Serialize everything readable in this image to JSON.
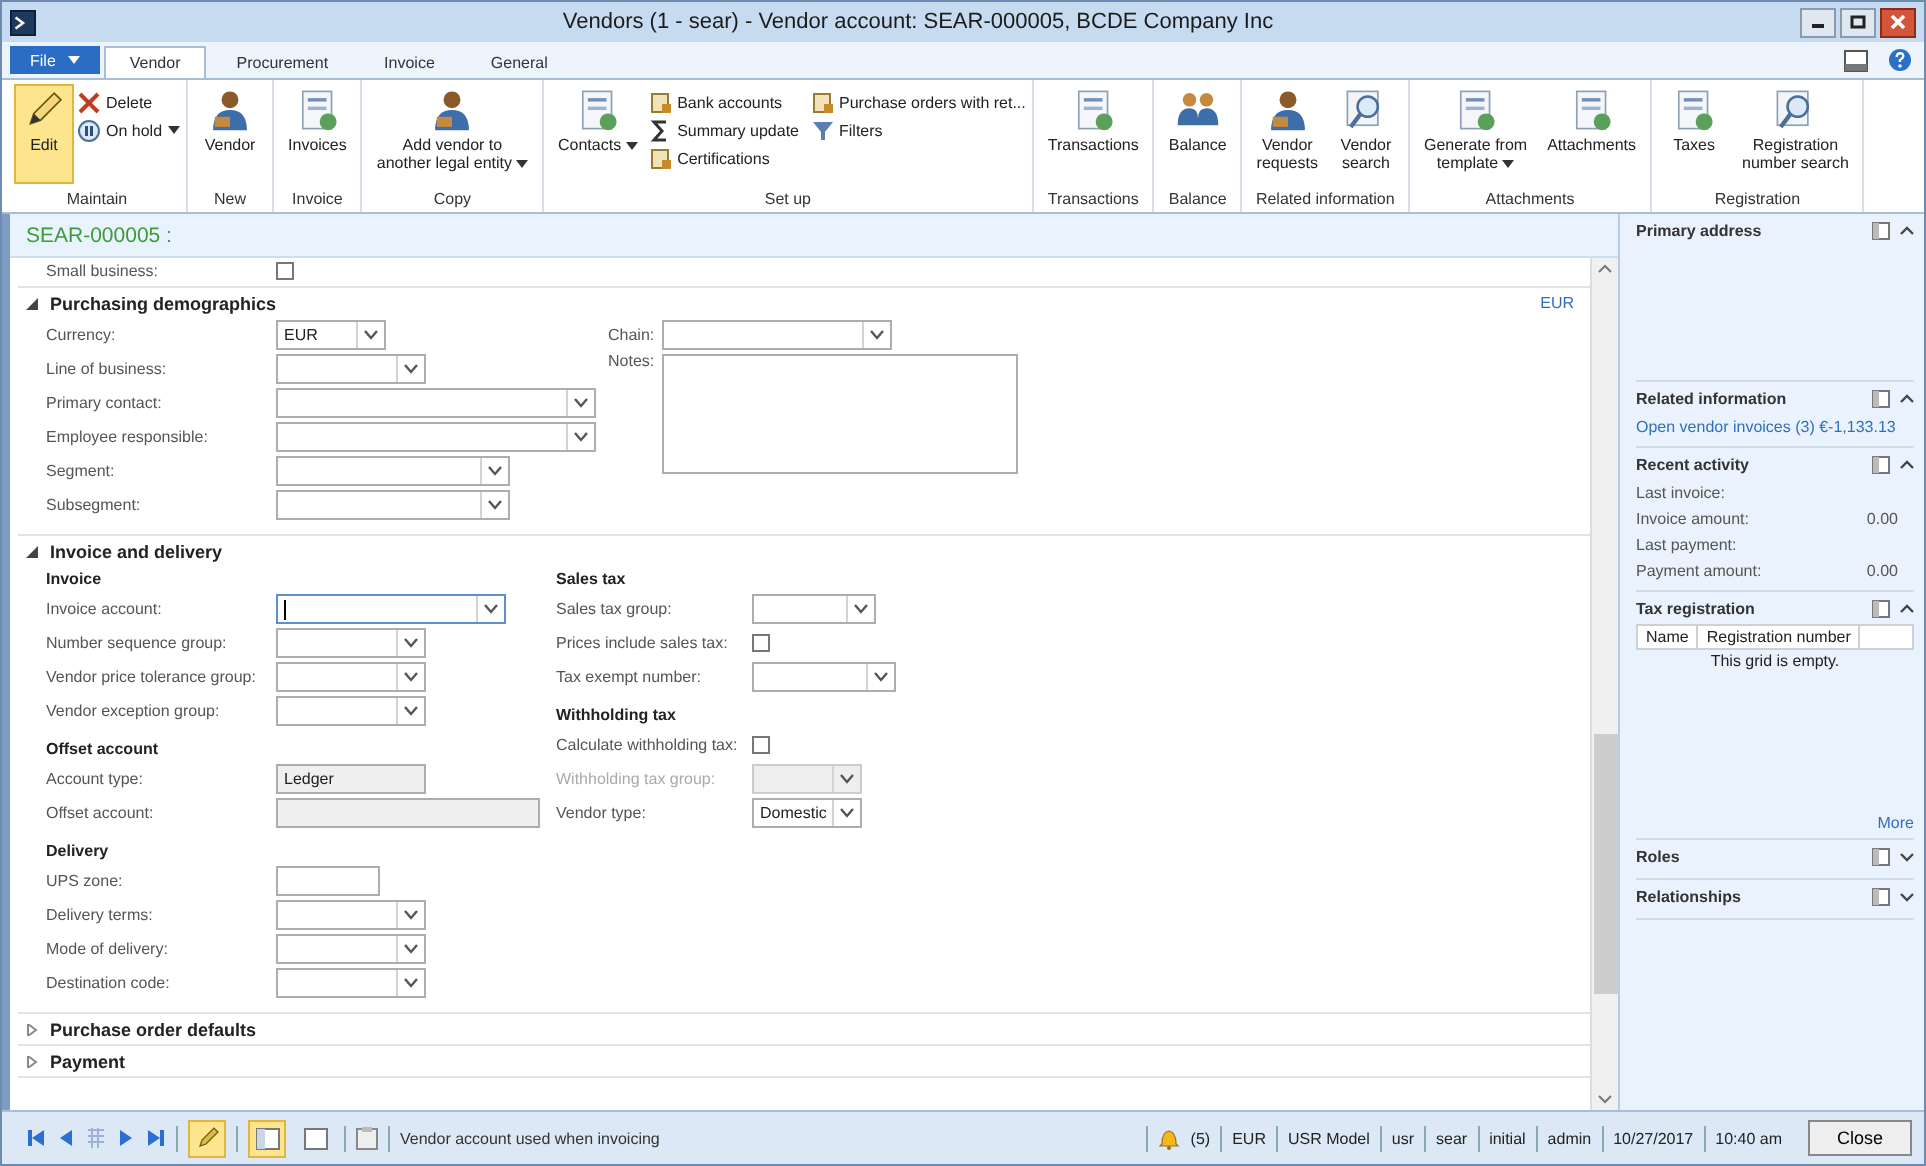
{
  "window": {
    "title": "Vendors (1 - sear) - Vendor account: SEAR-000005, BCDE Company Inc"
  },
  "tabs": [
    {
      "label": "File",
      "kind": "file",
      "selected": false
    },
    {
      "label": "Vendor",
      "kind": "tab",
      "selected": true
    },
    {
      "label": "Procurement",
      "kind": "tab",
      "selected": false
    },
    {
      "label": "Invoice",
      "kind": "tab",
      "selected": false
    },
    {
      "label": "General",
      "kind": "tab",
      "selected": false
    }
  ],
  "ribbon": {
    "groups": [
      {
        "label": "Maintain",
        "buttons": [
          {
            "label": "Edit",
            "kind": "large",
            "on": true
          },
          {
            "label": "Delete",
            "kind": "small",
            "on": false
          },
          {
            "label": "On hold",
            "kind": "small",
            "on": false,
            "dropdown": true
          }
        ]
      },
      {
        "label": "New",
        "buttons": [
          {
            "label": "Vendor",
            "kind": "large",
            "on": false
          }
        ]
      },
      {
        "label": "Invoice",
        "buttons": [
          {
            "label": "Invoices",
            "kind": "large",
            "on": false
          }
        ]
      },
      {
        "label": "Copy",
        "buttons": [
          {
            "label": "Add vendor to\nanother legal entity",
            "kind": "large",
            "on": false,
            "dropdown": true
          }
        ]
      },
      {
        "label": "Set up",
        "buttons": [
          {
            "label": "Contacts",
            "kind": "large",
            "on": false,
            "dropdown": true
          },
          {
            "label": "Bank accounts",
            "kind": "small",
            "on": false
          },
          {
            "label": "Summary update",
            "kind": "small",
            "on": false
          },
          {
            "label": "Certifications",
            "kind": "small",
            "on": false
          },
          {
            "label": "Purchase orders with ret...",
            "kind": "small",
            "on": false
          },
          {
            "label": "Filters",
            "kind": "small",
            "on": false
          }
        ]
      },
      {
        "label": "Transactions",
        "buttons": [
          {
            "label": "Transactions",
            "kind": "large",
            "on": false
          }
        ]
      },
      {
        "label": "Balance",
        "buttons": [
          {
            "label": "Balance",
            "kind": "large",
            "on": false
          }
        ]
      },
      {
        "label": "Related information",
        "buttons": [
          {
            "label": "Vendor\nrequests",
            "kind": "large",
            "on": false
          },
          {
            "label": "Vendor\nsearch",
            "kind": "large",
            "on": false
          }
        ]
      },
      {
        "label": "Attachments",
        "buttons": [
          {
            "label": "Generate from\ntemplate",
            "kind": "large",
            "on": false,
            "dropdown": true
          },
          {
            "label": "Attachments",
            "kind": "large",
            "on": false
          }
        ]
      },
      {
        "label": "Registration",
        "buttons": [
          {
            "label": "Taxes",
            "kind": "large",
            "on": false
          },
          {
            "label": "Registration\nnumber search",
            "kind": "large",
            "on": false
          }
        ]
      }
    ]
  },
  "form": {
    "heading": "SEAR-000005 :",
    "partial_row": {
      "label": "Small business:",
      "checked": false
    },
    "sections": [
      {
        "title": "Purchasing demographics",
        "expanded": true,
        "link": "EUR",
        "columns": [
          [
            {
              "fields": [
                {
                  "label": "Currency:",
                  "kind": "combo",
                  "value": "EUR"
                },
                {
                  "label": "Line of business:",
                  "kind": "combo"
                },
                {
                  "label": "Primary contact:",
                  "kind": "combo"
                },
                {
                  "label": "Employee responsible:",
                  "kind": "combo"
                },
                {
                  "label": "Segment:",
                  "kind": "combo"
                },
                {
                  "label": "Subsegment:",
                  "kind": "combo"
                }
              ]
            }
          ],
          [
            {
              "fields": [
                {
                  "label": "Chain:",
                  "kind": "combo"
                },
                {
                  "label": "Notes:",
                  "kind": "memo"
                }
              ]
            }
          ]
        ]
      },
      {
        "title": "Invoice and delivery",
        "expanded": true,
        "columns": [
          [
            {
              "heading": "Invoice",
              "fields": [
                {
                  "label": "Invoice account:",
                  "kind": "combo",
                  "focused": true
                },
                {
                  "label": "Number sequence group:",
                  "kind": "combo"
                },
                {
                  "label": "Vendor price tolerance group:",
                  "kind": "combo"
                },
                {
                  "label": "Vendor exception group:",
                  "kind": "combo"
                }
              ]
            },
            {
              "heading": "Offset account",
              "fields": [
                {
                  "label": "Account type:",
                  "kind": "readonly",
                  "value": "Ledger"
                },
                {
                  "label": "Offset account:",
                  "kind": "readonly"
                }
              ]
            },
            {
              "heading": "Delivery",
              "fields": [
                {
                  "label": "UPS zone:",
                  "kind": "text"
                },
                {
                  "label": "Delivery terms:",
                  "kind": "combo"
                },
                {
                  "label": "Mode of delivery:",
                  "kind": "combo"
                },
                {
                  "label": "Destination code:",
                  "kind": "combo"
                }
              ]
            }
          ],
          [
            {
              "heading": "Sales tax",
              "fields": [
                {
                  "label": "Sales tax group:",
                  "kind": "combo"
                },
                {
                  "label": "Prices include sales tax:",
                  "kind": "checkbox",
                  "checked": false
                },
                {
                  "label": "Tax exempt number:",
                  "kind": "combo"
                }
              ]
            },
            {
              "heading": "Withholding tax",
              "fields": [
                {
                  "label": "Calculate withholding tax:",
                  "kind": "checkbox",
                  "checked": false
                },
                {
                  "label": "Withholding tax group:",
                  "kind": "combo",
                  "disabled": true
                },
                {
                  "label": "Vendor type:",
                  "kind": "combo",
                  "value": "Domestic"
                }
              ]
            }
          ]
        ]
      },
      {
        "title": "Purchase order defaults",
        "expanded": false
      },
      {
        "title": "Payment",
        "expanded": false
      }
    ]
  },
  "factboxes": [
    {
      "title": "Primary address",
      "expanded": true,
      "kind": "empty"
    },
    {
      "title": "Related information",
      "expanded": true,
      "kind": "links",
      "links": [
        "Open vendor invoices (3) €-1,133.13"
      ]
    },
    {
      "title": "Recent activity",
      "expanded": true,
      "kind": "values",
      "rows": [
        {
          "label": "Last invoice:"
        },
        {
          "label": "Invoice amount:",
          "value": "0.00"
        },
        {
          "label": "Last payment:"
        },
        {
          "label": "Payment amount:",
          "value": "0.00"
        }
      ]
    },
    {
      "title": "Tax registration",
      "expanded": true,
      "kind": "grid",
      "columns": [
        "Name",
        "Registration number"
      ],
      "empty_text": "This grid is empty.",
      "more": "More"
    },
    {
      "title": "Roles",
      "expanded": false,
      "kind": "empty"
    },
    {
      "title": "Relationships",
      "expanded": false,
      "kind": "empty"
    }
  ],
  "status_bar": {
    "toggles": [
      {
        "on": true
      },
      {
        "on": true
      },
      {
        "on": false
      }
    ],
    "message": "Vendor account used when invoicing",
    "alerts": "(5)",
    "items": [
      "EUR",
      "USR Model",
      "usr",
      "sear",
      "initial",
      "admin",
      "10/27/2017",
      "10:40 am"
    ],
    "close": "Close"
  }
}
